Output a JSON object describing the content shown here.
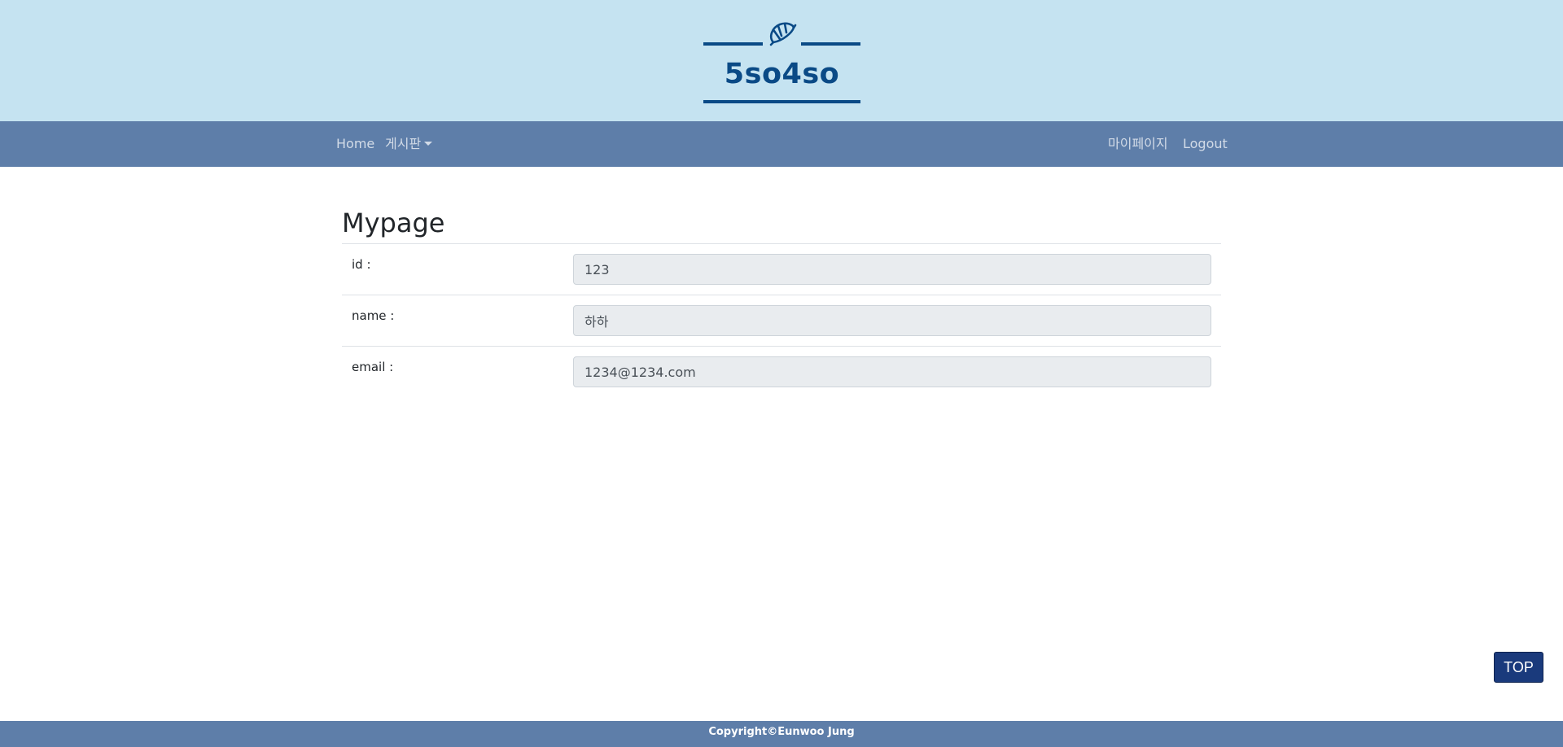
{
  "header": {
    "logo_title": "5so4so",
    "logo_icon": "croissant-icon",
    "colors": {
      "banner_bg": "#c5e3f1",
      "logo": "#0a4a86"
    }
  },
  "navbar": {
    "home_label": "Home",
    "board_label": "게시판",
    "mypage_label": "마이페이지",
    "logout_label": "Logout",
    "bg_color": "#5e7ea9"
  },
  "main": {
    "title": "Mypage",
    "fields": [
      {
        "label": "id :",
        "value": "123"
      },
      {
        "label": "name :",
        "value": "하하"
      },
      {
        "label": "email :",
        "value": "1234@1234.com"
      }
    ]
  },
  "top_button": {
    "label": "TOP",
    "color": "#1a3a7c"
  },
  "footer": {
    "copyright": "Copyright©Eunwoo Jung"
  }
}
